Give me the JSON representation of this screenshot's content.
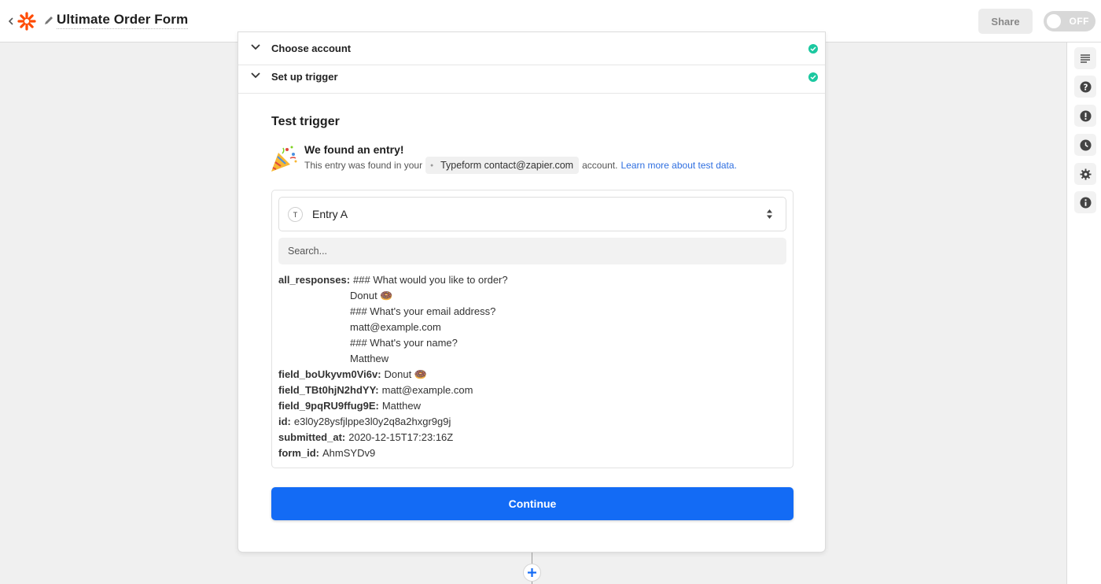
{
  "header": {
    "title": "Ultimate Order Form",
    "share_label": "Share",
    "toggle_label": "OFF"
  },
  "steps": [
    {
      "label": "Choose account",
      "status": "complete"
    },
    {
      "label": "Set up trigger",
      "status": "complete"
    }
  ],
  "test": {
    "title": "Test trigger",
    "found_title": "We found an entry!",
    "found_prefix": "This entry was found in your",
    "account_label": "Typeform contact@zapier.com",
    "found_suffix": "account.",
    "learn_more": "Learn more about test data."
  },
  "entry": {
    "selected": "Entry A",
    "icon_letter": "T",
    "search_placeholder": "Search..."
  },
  "fields": {
    "all_responses": {
      "key": "all_responses:",
      "lines": [
        "### What would you like to order?",
        "Donut 🍩",
        "### What's your email address?",
        "matt@example.com",
        "### What's your name?",
        "Matthew"
      ]
    },
    "rows": [
      {
        "key": "field_boUkyvm0Vi6v:",
        "value": "Donut 🍩"
      },
      {
        "key": "field_TBt0hjN2hdYY:",
        "value": "matt@example.com"
      },
      {
        "key": "field_9pqRU9ffug9E:",
        "value": "Matthew"
      },
      {
        "key": "id:",
        "value": "e3l0y28ysfjlppe3l0y2q8a2hxgr9g9j"
      },
      {
        "key": "submitted_at:",
        "value": "2020-12-15T17:23:16Z"
      },
      {
        "key": "form_id:",
        "value": "AhmSYDv9"
      }
    ]
  },
  "continue_label": "Continue",
  "colors": {
    "primary": "#136bf5",
    "success": "#1bc8a0",
    "brand": "#ff4a00"
  }
}
